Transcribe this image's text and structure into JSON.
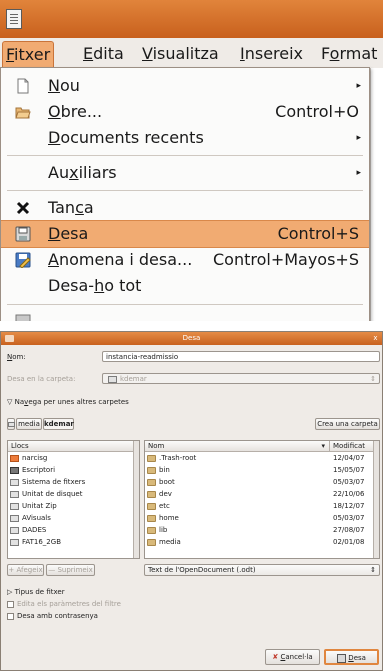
{
  "menubar": {
    "items": [
      {
        "label": "Fitxer",
        "mnemonic": "F",
        "rest": "itxer"
      },
      {
        "label": "Edita",
        "mnemonic": "E",
        "rest": "dita"
      },
      {
        "label": "Visualitza",
        "mnemonic": "V",
        "rest": "isualitza"
      },
      {
        "label": "Insereix",
        "mnemonic": "I",
        "rest": "nsereix"
      },
      {
        "label": "Format",
        "pre": "F",
        "mnemonic": "o",
        "rest": "rmat"
      }
    ]
  },
  "file_menu": {
    "nou": {
      "pre": "",
      "mn": "N",
      "post": "ou"
    },
    "obre": {
      "pre": "",
      "mn": "O",
      "post": "bre...",
      "shortcut": "Control+O"
    },
    "recents": {
      "pre": "",
      "mn": "D",
      "post": "ocuments recents"
    },
    "auxiliars": {
      "pre": "Au",
      "mn": "x",
      "post": "iliars"
    },
    "tanca": {
      "pre": "Tan",
      "mn": "c",
      "post": "a"
    },
    "desa": {
      "pre": "",
      "mn": "D",
      "post": "esa",
      "shortcut": "Control+S"
    },
    "anomena": {
      "pre": "",
      "mn": "A",
      "post": "nomena i desa...",
      "shortcut": "Control+Mayos+S"
    },
    "desatot": {
      "pre": "Desa-",
      "mn": "h",
      "post": "o tot"
    },
    "submenu_arrow": "▸"
  },
  "dialog": {
    "title": "Desa",
    "close": "x",
    "name_label_mn": "N",
    "name_label_rest": "om:",
    "name_value": "instancia-readmissio",
    "folder_label": "Desa en la carpeta:",
    "folder_value": "kdemar",
    "browse_arrow": "▽",
    "browse_label_pre": "Na",
    "browse_label_mn": "v",
    "browse_label_post": "ega per unes altres carpetes",
    "crumbs": [
      "media",
      "kdemar"
    ],
    "create_folder": "Crea una carpeta",
    "places_header": "Llocs",
    "places": [
      "narcisg",
      "Escriptori",
      "Sistema de fitxers",
      "Unitat de disquet",
      "Unitat Zip",
      "AVisuals",
      "DADES",
      "FAT16_2GB"
    ],
    "files_col_name": "Nom",
    "files_col_modified": "Modificat",
    "files": [
      {
        "name": ".Trash-root",
        "date": "12/04/07"
      },
      {
        "name": "bin",
        "date": "15/05/07"
      },
      {
        "name": "boot",
        "date": "05/03/07"
      },
      {
        "name": "dev",
        "date": "22/10/06"
      },
      {
        "name": "etc",
        "date": "18/12/07"
      },
      {
        "name": "home",
        "date": "05/03/07"
      },
      {
        "name": "lib",
        "date": "27/08/07"
      },
      {
        "name": "media",
        "date": "02/01/08"
      }
    ],
    "add_button": "Afegeix",
    "remove_button": "Suprimeix",
    "filetype": "Text de l'OpenDocument (.odt)",
    "filetype_label": "Tipus de fitxer",
    "edit_filter": "Edita els paràmetres del filtre",
    "password": "Desa amb contrasenya",
    "cancel_mn": "C",
    "cancel_rest": "ancel·la",
    "save_mn": "D",
    "save_rest": "esa"
  },
  "colors": {
    "accent": "#f1ab72",
    "titlebar": "#d6702b",
    "menu_bg": "#fbfbfa"
  }
}
